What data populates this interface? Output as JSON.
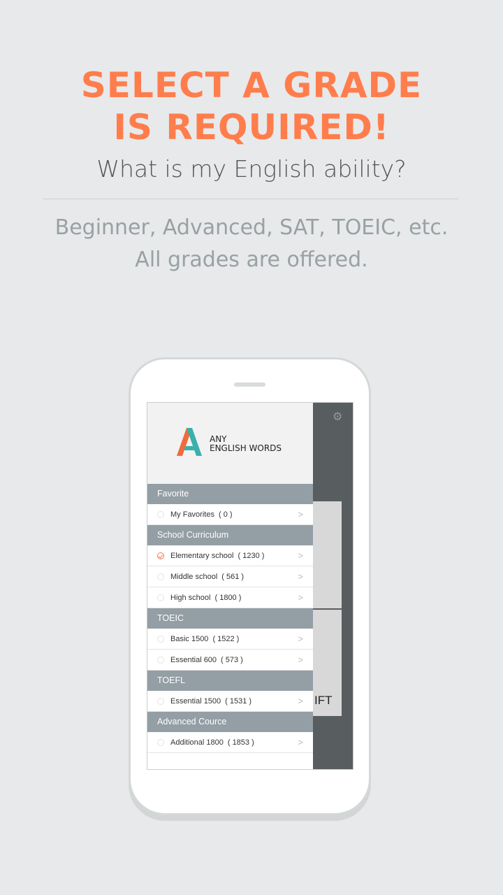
{
  "headline": {
    "line1": "SELECT A GRADE",
    "line2": "IS REQUIRED!"
  },
  "subtitle": "What is my English ability?",
  "description": {
    "line1": "Beginner, Advanced, SAT, TOEIC, etc.",
    "line2": "All grades are offered."
  },
  "app": {
    "logo_line1": "ANY",
    "logo_line2": "ENGLISH WORDS",
    "background_partial_text": "IFT",
    "sections": [
      {
        "title": "Favorite",
        "items": [
          {
            "label": "My Favorites",
            "count": "( 0 )",
            "selected": false
          }
        ]
      },
      {
        "title": "School Curriculum",
        "items": [
          {
            "label": "Elementary school",
            "count": "( 1230 )",
            "selected": true
          },
          {
            "label": "Middle school",
            "count": "( 561 )",
            "selected": false
          },
          {
            "label": "High school",
            "count": "( 1800 )",
            "selected": false
          }
        ]
      },
      {
        "title": "TOEIC",
        "items": [
          {
            "label": "Basic 1500",
            "count": "( 1522 )",
            "selected": false
          },
          {
            "label": "Essential 600",
            "count": "( 573 )",
            "selected": false
          }
        ]
      },
      {
        "title": "TOEFL",
        "items": [
          {
            "label": "Essential 1500",
            "count": "( 1531 )",
            "selected": false
          }
        ]
      },
      {
        "title": "Advanced Cource",
        "items": [
          {
            "label": "Additional 1800",
            "count": "( 1853 )",
            "selected": false
          }
        ]
      }
    ]
  },
  "colors": {
    "accent": "#ff7d4c",
    "section_header": "#939ea5"
  }
}
